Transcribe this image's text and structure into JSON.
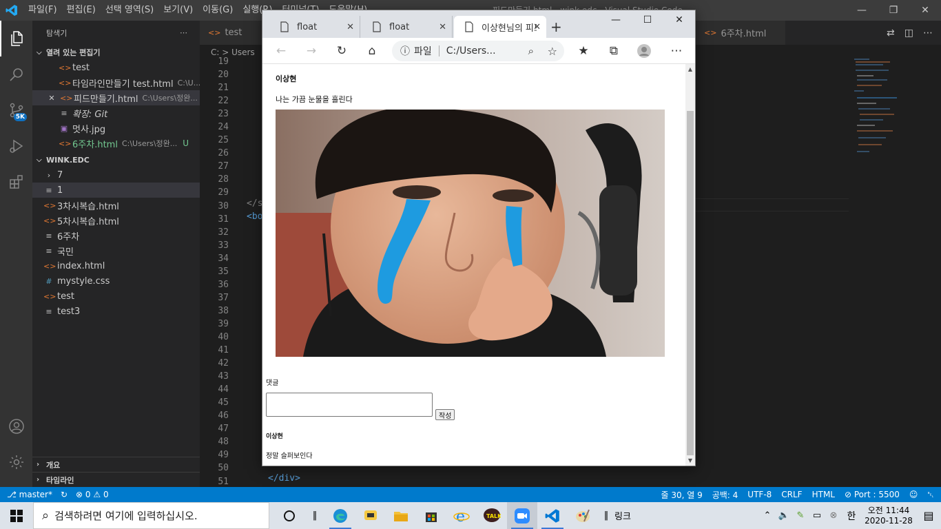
{
  "vscode": {
    "menu": [
      "파일(F)",
      "편집(E)",
      "선택 영역(S)",
      "보기(V)",
      "이동(G)",
      "실행(R)",
      "터미널(T)",
      "도움말(H)"
    ],
    "window_title": "피드만들기.html - wink.edc - Visual Studio Code",
    "explorer_title": "탐색기",
    "open_editors_header": "열려 있는 편집기",
    "open_editors": [
      {
        "label": "test",
        "path": "",
        "icon": "html-icon"
      },
      {
        "label": "타임라인만들기 test.html",
        "path": "C:\\U...",
        "icon": "html-icon"
      },
      {
        "label": "피드만들기.html",
        "path": "C:\\Users\\정완...",
        "icon": "html-icon"
      },
      {
        "label": "확장: Git",
        "path": "",
        "icon": "extension-icon"
      },
      {
        "label": "멋사.jpg",
        "path": "",
        "icon": "image-icon"
      },
      {
        "label": "6주차.html",
        "path": "C:\\Users\\정완...",
        "icon": "html-icon",
        "status": "U"
      }
    ],
    "workspace_header": "WINK.EDC",
    "files": [
      {
        "label": "7",
        "icon": "folder"
      },
      {
        "label": "1",
        "icon": "txt"
      },
      {
        "label": "3차시복습.html",
        "icon": "html"
      },
      {
        "label": "5차시복습.html",
        "icon": "html"
      },
      {
        "label": "6주차",
        "icon": "txt"
      },
      {
        "label": "국민",
        "icon": "txt"
      },
      {
        "label": "index.html",
        "icon": "html"
      },
      {
        "label": "mystyle.css",
        "icon": "css"
      },
      {
        "label": "test",
        "icon": "html"
      },
      {
        "label": "test3",
        "icon": "txt"
      }
    ],
    "outline_header": "개요",
    "timeline_header": "타임라인",
    "source_control_badge": "5K",
    "editor_tabs": {
      "left": "test",
      "right": "6주차.html"
    },
    "breadcrumb": "C: > Users",
    "line_numbers": [
      "19",
      "20",
      "21",
      "22",
      "23",
      "24",
      "25",
      "26",
      "27",
      "28",
      "29",
      "30",
      "31",
      "32",
      "33",
      "34",
      "35",
      "36",
      "37",
      "38",
      "39",
      "40",
      "41",
      "42",
      "43",
      "44",
      "45",
      "46",
      "47",
      "48",
      "49",
      "50",
      "51"
    ],
    "code_visible": {
      "line30": "</s",
      "line31": "<bo",
      "line50": "</div>",
      "line51": "</div>"
    }
  },
  "statusbar": {
    "branch": "master*",
    "errors": "0",
    "warnings": "0",
    "position": "줄 30, 열 9",
    "spaces": "공백: 4",
    "encoding": "UTF-8",
    "eol": "CRLF",
    "language": "HTML",
    "port": "Port : 5500"
  },
  "browser": {
    "tabs": [
      "float",
      "float",
      "이상현님의 피드"
    ],
    "address_scheme": "파일",
    "address": "C:/Users...",
    "post": {
      "author": "이상현",
      "text": "나는 가끔 눈물을 흘린다",
      "comment_label": "댓글",
      "submit_label": "작성",
      "comment_author": "이상현",
      "comment_text": "정말 슬퍼보인다"
    }
  },
  "taskbar": {
    "search_placeholder": "검색하려면 여기에 입력하십시오.",
    "links_label": "링크",
    "ime": "한",
    "time": "오전 11:44",
    "date": "2020-11-28"
  }
}
